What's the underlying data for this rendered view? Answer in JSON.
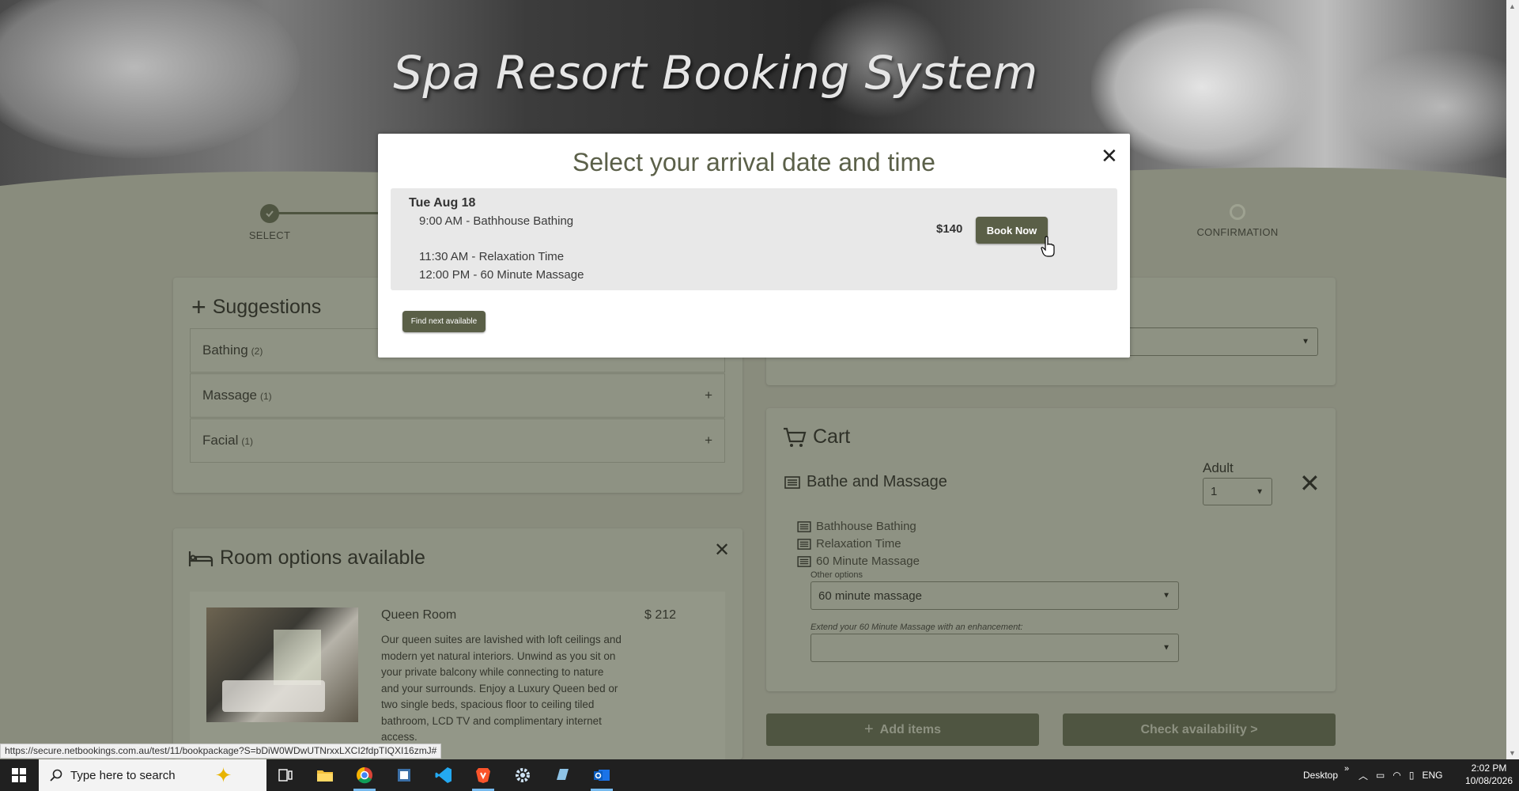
{
  "header": {
    "title": "Spa Resort Booking System"
  },
  "stepper": {
    "select": "SELECT",
    "confirmation": "CONFIRMATION"
  },
  "suggestions": {
    "title": "Suggestions",
    "items": [
      {
        "label": "Bathing",
        "count": "(2)"
      },
      {
        "label": "Massage",
        "count": "(1)"
      },
      {
        "label": "Facial",
        "count": "(1)"
      }
    ]
  },
  "rooms": {
    "title": "Room options available",
    "room": {
      "name": "Queen Room",
      "price": "$ 212",
      "description": "Our queen suites are lavished with loft ceilings and modern yet natural interiors.  Unwind as you sit on your private balcony while connecting to nature and your surrounds. Enjoy a Luxury Queen bed or two single beds, spacious floor to ceiling tiled bathroom, LCD TV and complimentary internet access."
    }
  },
  "cart": {
    "title": "Cart",
    "item_title": "Bathe and Massage",
    "adult_label": "Adult",
    "adult_value": "1",
    "sub_items": [
      "Bathhouse Bathing",
      "Relaxation Time",
      "60 Minute Massage"
    ],
    "other_options_label": "Other options",
    "other_options_value": "60 minute massage",
    "enhancement_label": "Extend your 60 Minute Massage with an enhancement:",
    "enhancement_value": ""
  },
  "actions": {
    "add_items": "Add items",
    "check_availability": "Check availability >"
  },
  "modal": {
    "title": "Select your arrival date and time",
    "date": "Tue Aug 18",
    "schedule": [
      "9:00 AM - Bathhouse Bathing",
      "11:30 AM - Relaxation Time",
      "12:00 PM - 60 Minute Massage"
    ],
    "price": "$140",
    "book_now": "Book Now",
    "find_next": "Find next available"
  },
  "status_url": "https://secure.netbookings.com.au/test/11/bookpackage?S=bDiW0WDwUTNrxxLXCI2fdpTIQXI16zmJ#",
  "taskbar": {
    "search_placeholder": "Type here to search",
    "desktop_label": "Desktop",
    "language": "ENG",
    "time": "2:02 PM",
    "date": "10/08/2026"
  },
  "colors": {
    "accent": "#5a5f47",
    "background": "#8d9181",
    "modal_row": "#e8e8e8"
  }
}
